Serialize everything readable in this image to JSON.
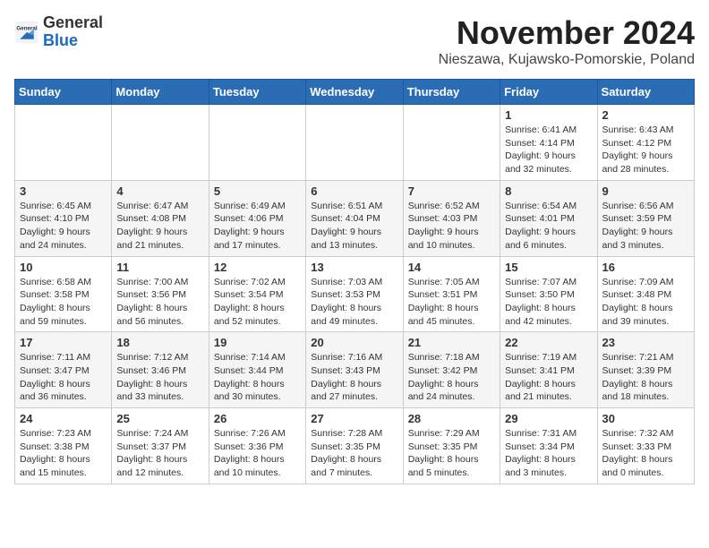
{
  "header": {
    "logo_general": "General",
    "logo_blue": "Blue",
    "title": "November 2024",
    "subtitle": "Nieszawa, Kujawsko-Pomorskie, Poland"
  },
  "weekdays": [
    "Sunday",
    "Monday",
    "Tuesday",
    "Wednesday",
    "Thursday",
    "Friday",
    "Saturday"
  ],
  "weeks": [
    [
      {
        "day": "",
        "info": ""
      },
      {
        "day": "",
        "info": ""
      },
      {
        "day": "",
        "info": ""
      },
      {
        "day": "",
        "info": ""
      },
      {
        "day": "",
        "info": ""
      },
      {
        "day": "1",
        "info": "Sunrise: 6:41 AM\nSunset: 4:14 PM\nDaylight: 9 hours\nand 32 minutes."
      },
      {
        "day": "2",
        "info": "Sunrise: 6:43 AM\nSunset: 4:12 PM\nDaylight: 9 hours\nand 28 minutes."
      }
    ],
    [
      {
        "day": "3",
        "info": "Sunrise: 6:45 AM\nSunset: 4:10 PM\nDaylight: 9 hours\nand 24 minutes."
      },
      {
        "day": "4",
        "info": "Sunrise: 6:47 AM\nSunset: 4:08 PM\nDaylight: 9 hours\nand 21 minutes."
      },
      {
        "day": "5",
        "info": "Sunrise: 6:49 AM\nSunset: 4:06 PM\nDaylight: 9 hours\nand 17 minutes."
      },
      {
        "day": "6",
        "info": "Sunrise: 6:51 AM\nSunset: 4:04 PM\nDaylight: 9 hours\nand 13 minutes."
      },
      {
        "day": "7",
        "info": "Sunrise: 6:52 AM\nSunset: 4:03 PM\nDaylight: 9 hours\nand 10 minutes."
      },
      {
        "day": "8",
        "info": "Sunrise: 6:54 AM\nSunset: 4:01 PM\nDaylight: 9 hours\nand 6 minutes."
      },
      {
        "day": "9",
        "info": "Sunrise: 6:56 AM\nSunset: 3:59 PM\nDaylight: 9 hours\nand 3 minutes."
      }
    ],
    [
      {
        "day": "10",
        "info": "Sunrise: 6:58 AM\nSunset: 3:58 PM\nDaylight: 8 hours\nand 59 minutes."
      },
      {
        "day": "11",
        "info": "Sunrise: 7:00 AM\nSunset: 3:56 PM\nDaylight: 8 hours\nand 56 minutes."
      },
      {
        "day": "12",
        "info": "Sunrise: 7:02 AM\nSunset: 3:54 PM\nDaylight: 8 hours\nand 52 minutes."
      },
      {
        "day": "13",
        "info": "Sunrise: 7:03 AM\nSunset: 3:53 PM\nDaylight: 8 hours\nand 49 minutes."
      },
      {
        "day": "14",
        "info": "Sunrise: 7:05 AM\nSunset: 3:51 PM\nDaylight: 8 hours\nand 45 minutes."
      },
      {
        "day": "15",
        "info": "Sunrise: 7:07 AM\nSunset: 3:50 PM\nDaylight: 8 hours\nand 42 minutes."
      },
      {
        "day": "16",
        "info": "Sunrise: 7:09 AM\nSunset: 3:48 PM\nDaylight: 8 hours\nand 39 minutes."
      }
    ],
    [
      {
        "day": "17",
        "info": "Sunrise: 7:11 AM\nSunset: 3:47 PM\nDaylight: 8 hours\nand 36 minutes."
      },
      {
        "day": "18",
        "info": "Sunrise: 7:12 AM\nSunset: 3:46 PM\nDaylight: 8 hours\nand 33 minutes."
      },
      {
        "day": "19",
        "info": "Sunrise: 7:14 AM\nSunset: 3:44 PM\nDaylight: 8 hours\nand 30 minutes."
      },
      {
        "day": "20",
        "info": "Sunrise: 7:16 AM\nSunset: 3:43 PM\nDaylight: 8 hours\nand 27 minutes."
      },
      {
        "day": "21",
        "info": "Sunrise: 7:18 AM\nSunset: 3:42 PM\nDaylight: 8 hours\nand 24 minutes."
      },
      {
        "day": "22",
        "info": "Sunrise: 7:19 AM\nSunset: 3:41 PM\nDaylight: 8 hours\nand 21 minutes."
      },
      {
        "day": "23",
        "info": "Sunrise: 7:21 AM\nSunset: 3:39 PM\nDaylight: 8 hours\nand 18 minutes."
      }
    ],
    [
      {
        "day": "24",
        "info": "Sunrise: 7:23 AM\nSunset: 3:38 PM\nDaylight: 8 hours\nand 15 minutes."
      },
      {
        "day": "25",
        "info": "Sunrise: 7:24 AM\nSunset: 3:37 PM\nDaylight: 8 hours\nand 12 minutes."
      },
      {
        "day": "26",
        "info": "Sunrise: 7:26 AM\nSunset: 3:36 PM\nDaylight: 8 hours\nand 10 minutes."
      },
      {
        "day": "27",
        "info": "Sunrise: 7:28 AM\nSunset: 3:35 PM\nDaylight: 8 hours\nand 7 minutes."
      },
      {
        "day": "28",
        "info": "Sunrise: 7:29 AM\nSunset: 3:35 PM\nDaylight: 8 hours\nand 5 minutes."
      },
      {
        "day": "29",
        "info": "Sunrise: 7:31 AM\nSunset: 3:34 PM\nDaylight: 8 hours\nand 3 minutes."
      },
      {
        "day": "30",
        "info": "Sunrise: 7:32 AM\nSunset: 3:33 PM\nDaylight: 8 hours\nand 0 minutes."
      }
    ]
  ]
}
